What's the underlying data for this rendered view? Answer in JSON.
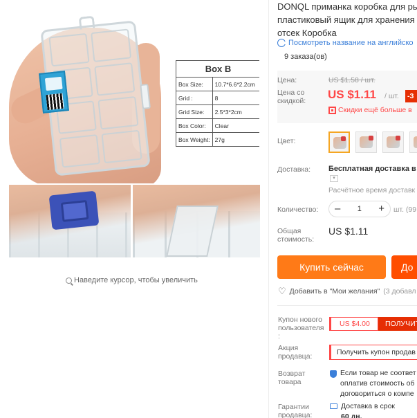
{
  "product": {
    "title_lines": [
      "DONQL приманка коробка для ры",
      "пластиковый ящик для хранения",
      "отсек Коробка"
    ],
    "translate_link": "Посмотреть название на английско",
    "orders": "9 заказа(ов)"
  },
  "gallery": {
    "spec_table": {
      "title": "Box B",
      "rows": [
        {
          "key": "Box Size:",
          "value": "10.7*6.6*2.2cm"
        },
        {
          "key": "Grid :",
          "value": "8"
        },
        {
          "key": "Grid Size:",
          "value": "2.5*3*2cm"
        },
        {
          "key": "Box Color:",
          "value": "Clear"
        },
        {
          "key": "Box Weight:",
          "value": "27g"
        }
      ]
    },
    "zoom_hint": "Наведите курсор, чтобы увеличить"
  },
  "price": {
    "label": "Цена:",
    "old": "US $1.58 / шт.",
    "discount_label_lines": [
      "Цена со",
      "скидкой:"
    ],
    "sale": "US $1.11",
    "unit": "/ шт.",
    "badge": "-3",
    "promo": "Скидки ещё больше в"
  },
  "color": {
    "label": "Цвет:",
    "swatches": [
      "box-a",
      "box-b",
      "box-c",
      "box-d"
    ],
    "selected_index": 0
  },
  "shipping": {
    "label": "Доставка:",
    "main": "Бесплатная доставка в Р",
    "time": "Расчётное время доставк"
  },
  "quantity": {
    "label": "Количество:",
    "minus": "–",
    "value": "1",
    "plus": "+",
    "unit": "шт. (99"
  },
  "total": {
    "label_lines": [
      "Общая",
      "стоимость:"
    ],
    "value": "US $1.11"
  },
  "actions": {
    "buy_now": "Купить сейчас",
    "add_to_cart": "До",
    "wishlist": "Добавить в \"Мои желания\"",
    "wishlist_count": "(3 добавл"
  },
  "coupons": {
    "new_user_label_lines": [
      "Купон нового",
      "пользователя",
      ":"
    ],
    "new_user_value": "US $4.00",
    "new_user_button": "ПОЛУЧИТ",
    "seller_label_lines": [
      "Акция",
      "продавца:"
    ],
    "seller_button": "Получить купон продав"
  },
  "returns": {
    "label_lines": [
      "Возврат",
      "товара"
    ],
    "text_lines": [
      "Если товар не соответ",
      "оплатив стоимость об",
      "договориться о компе"
    ]
  },
  "guarantee": {
    "label_lines": [
      "Гарантии",
      "продавца:"
    ],
    "text_lines": [
      "Доставка в срок",
      "60 дн."
    ]
  },
  "colors": {
    "accent_red": "#ff4747",
    "buy_orange": "#ff7a17",
    "cart_orange": "#ff4e00",
    "link_blue": "#3b7fd9"
  }
}
